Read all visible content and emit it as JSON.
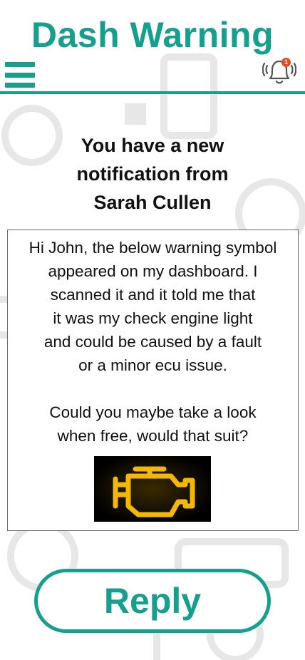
{
  "header": {
    "title": "Dash Warning",
    "menu_icon": "hamburger-menu-icon",
    "bell_icon": "bell-icon",
    "notification_count": "1"
  },
  "notification": {
    "heading": "You have a new\nnotification from\nSarah Cullen",
    "message": "Hi John, the below warning symbol\nappeared on my dashboard. I\nscanned it and it told me that\nit was my check engine light\nand could be caused by a fault\nor a minor ecu issue.\n\nCould you maybe take a look\nwhen free, would that suit?",
    "image_icon": "check-engine-light-icon"
  },
  "actions": {
    "reply_label": "Reply"
  },
  "colors": {
    "accent": "#14a08c",
    "badge": "#e84a24",
    "engine_light": "#f5b800"
  }
}
